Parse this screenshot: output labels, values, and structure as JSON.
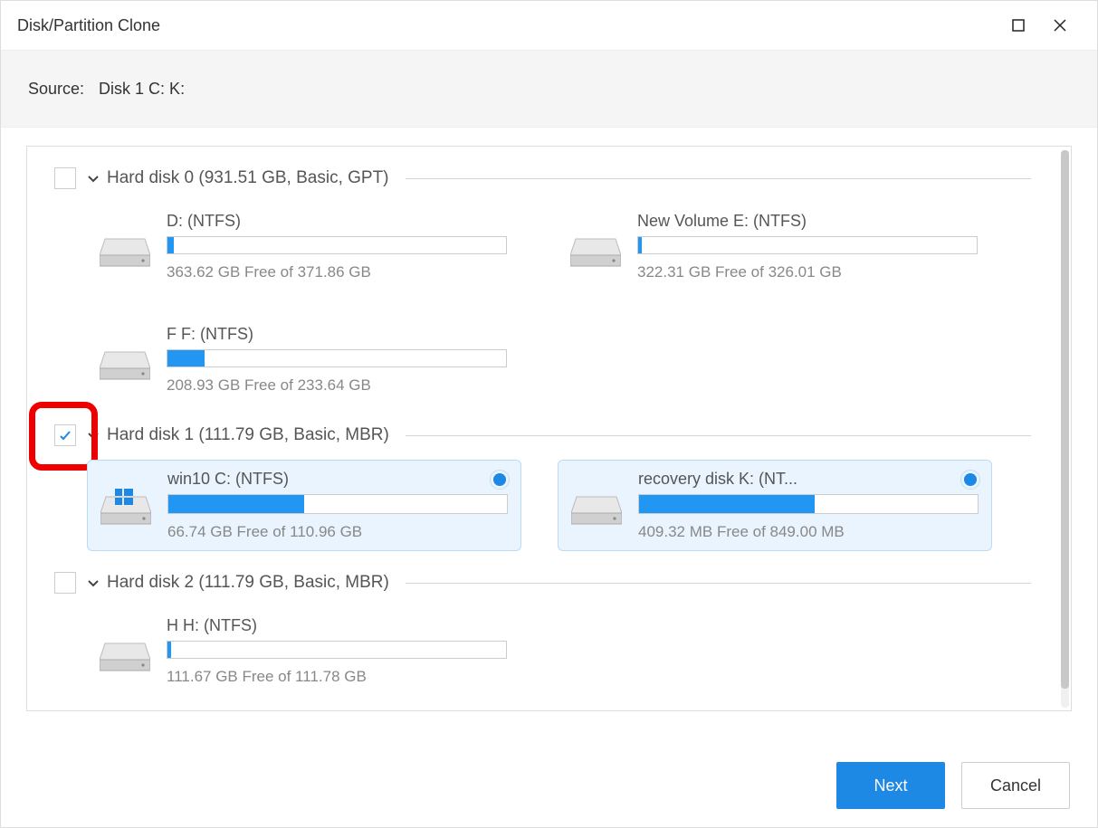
{
  "window": {
    "title": "Disk/Partition Clone",
    "source_label": "Source:",
    "source_value": "Disk 1 C: K:"
  },
  "disks": [
    {
      "checked": false,
      "highlight": false,
      "label": "Hard disk 0 (931.51 GB, Basic, GPT)",
      "parts": [
        {
          "name": "D: (NTFS)",
          "free": "363.62 GB Free of 371.86 GB",
          "pct": 2,
          "selected": false,
          "windows": false
        },
        {
          "name": "New Volume E: (NTFS)",
          "free": "322.31 GB Free of 326.01 GB",
          "pct": 1,
          "selected": false,
          "windows": false
        },
        {
          "name": "F F: (NTFS)",
          "free": "208.93 GB Free of 233.64 GB",
          "pct": 11,
          "selected": false,
          "windows": false
        }
      ]
    },
    {
      "checked": true,
      "highlight": true,
      "label": "Hard disk 1 (111.79 GB, Basic, MBR)",
      "parts": [
        {
          "name": "win10 C: (NTFS)",
          "free": "66.74 GB Free of 110.96 GB",
          "pct": 40,
          "selected": true,
          "windows": true
        },
        {
          "name": "recovery disk K: (NT...",
          "free": "409.32 MB Free of 849.00 MB",
          "pct": 52,
          "selected": true,
          "windows": false
        }
      ]
    },
    {
      "checked": false,
      "highlight": false,
      "label": "Hard disk 2 (111.79 GB, Basic, MBR)",
      "parts": [
        {
          "name": "H H: (NTFS)",
          "free": "111.67 GB Free of 111.78 GB",
          "pct": 1,
          "selected": false,
          "windows": false
        }
      ]
    }
  ],
  "buttons": {
    "next": "Next",
    "cancel": "Cancel"
  }
}
